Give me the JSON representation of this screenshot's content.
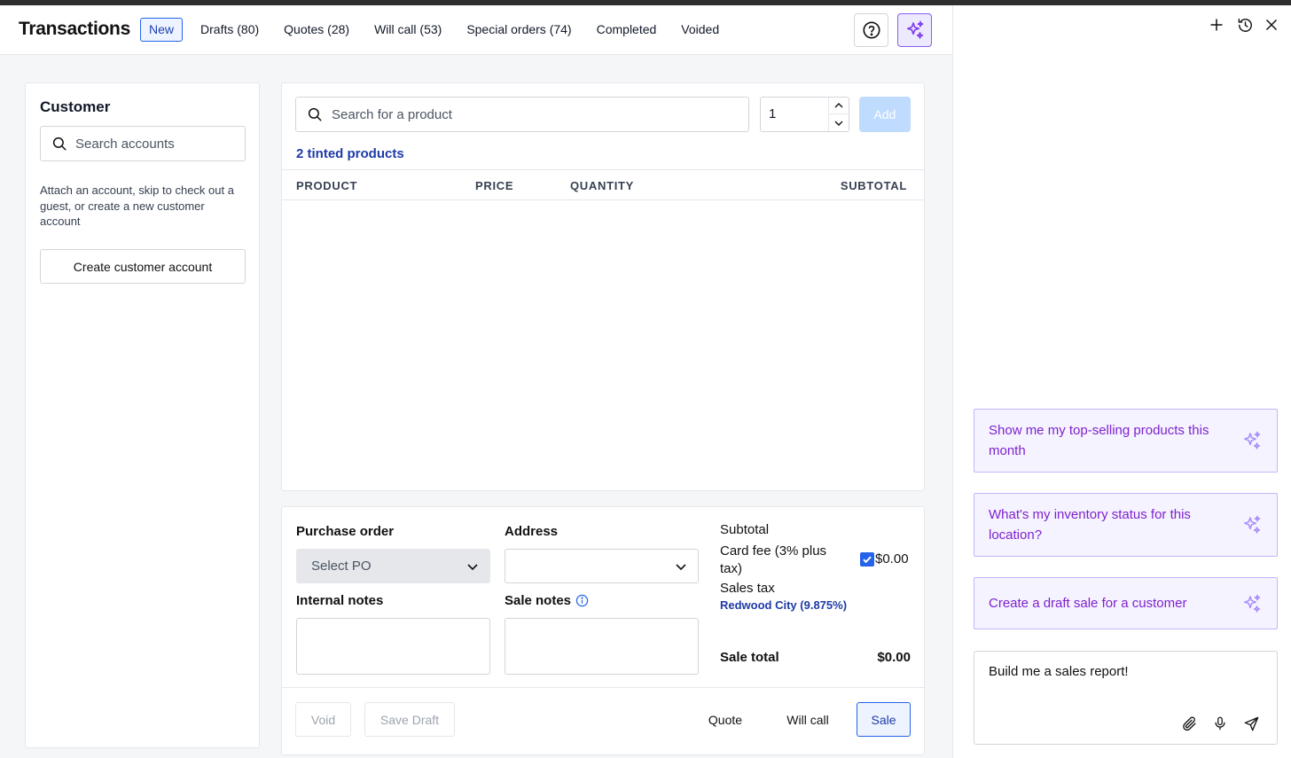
{
  "header": {
    "title": "Transactions",
    "tabs": [
      {
        "label": "New",
        "active": true
      },
      {
        "label": "Drafts (80)"
      },
      {
        "label": "Quotes (28)"
      },
      {
        "label": "Will call (53)"
      },
      {
        "label": "Special orders (74)"
      },
      {
        "label": "Completed"
      },
      {
        "label": "Voided"
      }
    ],
    "icons": [
      "help-circle-icon",
      "sparkles-icon"
    ]
  },
  "customer": {
    "heading": "Customer",
    "search_placeholder": "Search accounts",
    "help_text": "Attach an account, skip to check out a guest, or create a new customer account",
    "create_label": "Create customer account"
  },
  "products": {
    "search_placeholder": "Search for a product",
    "quantity": "1",
    "add_label": "Add",
    "tinted_link": "2 tinted products",
    "columns": [
      "PRODUCT",
      "PRICE",
      "QUANTITY",
      "SUBTOTAL"
    ]
  },
  "order": {
    "po_label": "Purchase order",
    "po_placeholder": "Select PO",
    "address_label": "Address",
    "internal_notes_label": "Internal notes",
    "sale_notes_label": "Sale notes",
    "subtotal_label": "Subtotal",
    "card_fee_label": "Card fee (3% plus tax)",
    "card_fee_checked": true,
    "card_fee_value": "$0.00",
    "sales_tax_label": "Sales tax",
    "tax_location": "Redwood City (9.875%)",
    "sale_total_label": "Sale total",
    "sale_total_value": "$0.00"
  },
  "footer": {
    "void_label": "Void",
    "save_draft_label": "Save Draft",
    "quote_label": "Quote",
    "will_call_label": "Will call",
    "sale_label": "Sale"
  },
  "assistant": {
    "suggestions": [
      "Show me my top-selling products this month",
      "What's my inventory status for this location?",
      "Create a draft sale for a customer"
    ],
    "input_text": "Build me a sales report!"
  },
  "colors": {
    "accent": "#2563eb",
    "link": "#1e3aa8",
    "ai_purple": "#7e22ce",
    "ai_border": "#c4b5fd"
  }
}
